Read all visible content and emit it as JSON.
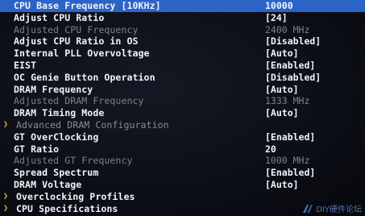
{
  "bios_settings": [
    {
      "label": "CPU Base Frequency [10KHz]",
      "value": "10000",
      "state": "selected"
    },
    {
      "label": "Adjust CPU Ratio",
      "value": "[24]",
      "state": "normal"
    },
    {
      "label": "Adjusted CPU Frequency",
      "value": "2400 MHz",
      "state": "disabled"
    },
    {
      "label": "Adjust CPU Ratio in OS",
      "value": "[Disabled]",
      "state": "normal"
    },
    {
      "label": "Internal PLL Overvoltage",
      "value": "[Auto]",
      "state": "normal"
    },
    {
      "label": "EIST",
      "value": "[Enabled]",
      "state": "normal"
    },
    {
      "label": "OC Genie Button Operation",
      "value": "[Disabled]",
      "state": "normal"
    },
    {
      "label": "DRAM Frequency",
      "value": "[Auto]",
      "state": "normal"
    },
    {
      "label": "Adjusted DRAM Frequency",
      "value": "1333 MHz",
      "state": "disabled"
    },
    {
      "label": "DRAM Timing Mode",
      "value": "[Auto]",
      "state": "normal"
    },
    {
      "label": "Advanced DRAM Configuration",
      "value": "",
      "state": "submenu-disabled"
    },
    {
      "label": "GT OverClocking",
      "value": "[Enabled]",
      "state": "normal"
    },
    {
      "label": "GT Ratio",
      "value": "20",
      "state": "normal"
    },
    {
      "label": "Adjusted GT Frequency",
      "value": "1000 MHz",
      "state": "disabled"
    },
    {
      "label": "Spread Spectrum",
      "value": "[Enabled]",
      "state": "normal"
    },
    {
      "label": "DRAM Voltage",
      "value": "[Auto]",
      "state": "normal"
    },
    {
      "label": "Overclocking Profiles",
      "value": "",
      "state": "submenu"
    },
    {
      "label": "CPU Specifications",
      "value": "",
      "state": "submenu"
    }
  ],
  "submenu_arrow": "❯",
  "watermark": {
    "text": "DIY硬件论坛",
    "icon": "diy-logo-icon",
    "color": "#5d8fcf"
  },
  "colors": {
    "background": "#0a0b12",
    "highlight": "#2b63c7",
    "text": "#f2f3f8",
    "disabled_text": "#7d808d",
    "arrow": "#e8b23a"
  }
}
